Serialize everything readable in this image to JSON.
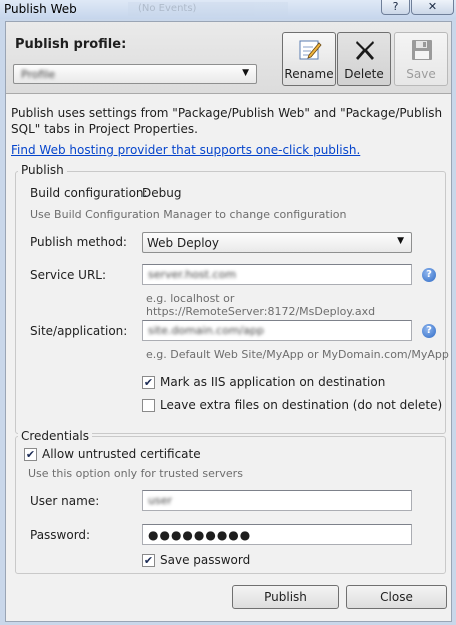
{
  "window": {
    "title": "Publish Web",
    "ghost_tab": "(No Events)",
    "help_label": "?",
    "close_label": "✕"
  },
  "header": {
    "profile_label": "Publish profile:",
    "profile_value": "Profile",
    "buttons": {
      "rename": "Rename",
      "delete": "Delete",
      "save": "Save"
    }
  },
  "info_text": "Publish uses settings from \"Package/Publish Web\" and \"Package/Publish SQL\" tabs in Project Properties.",
  "hosting_link": "Find Web hosting provider that supports one-click publish.",
  "publish_group": {
    "title": "Publish",
    "build_config_label": "Build configuration:",
    "build_config_value": "Debug",
    "build_config_hint": "Use Build Configuration Manager to change configuration",
    "method_label": "Publish method:",
    "method_value": "Web Deploy",
    "service_url_label": "Service URL:",
    "service_url_value": "server.host.com",
    "service_url_hint": "e.g. localhost or https://RemoteServer:8172/MsDeploy.axd",
    "site_label": "Site/application:",
    "site_value": "site.domain.com/app",
    "site_hint": "e.g. Default Web Site/MyApp or MyDomain.com/MyApp",
    "mark_iis_label": "Mark as IIS application on destination",
    "mark_iis_checked": true,
    "leave_extra_label": "Leave extra files on destination (do not delete)",
    "leave_extra_checked": false
  },
  "credentials_group": {
    "title": "Credentials",
    "allow_untrusted_label": "Allow untrusted certificate",
    "allow_untrusted_checked": true,
    "allow_untrusted_hint": "Use this option only for trusted servers",
    "username_label": "User name:",
    "username_value": "user",
    "password_label": "Password:",
    "password_value": "●●●●●●●●●",
    "save_password_label": "Save password",
    "save_password_checked": true
  },
  "footer": {
    "publish_label": "Publish",
    "close_label": "Close"
  },
  "icons": {
    "rename": "pencil-edit-icon",
    "delete": "x-delete-icon",
    "save": "floppy-disk-icon",
    "help": "help-question-icon"
  },
  "colors": {
    "link": "#0645cc",
    "help_icon": "#2f6bc5",
    "titlebar": "#c6d6ec"
  }
}
